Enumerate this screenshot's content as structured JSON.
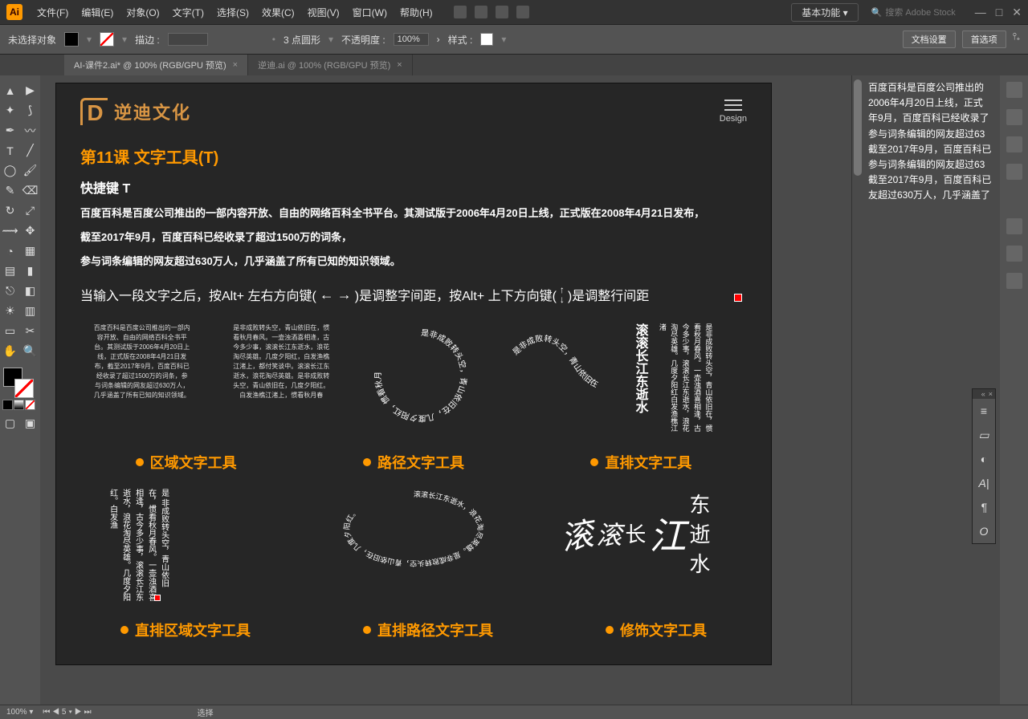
{
  "menubar": {
    "logo": "Ai",
    "items": [
      "文件(F)",
      "编辑(E)",
      "对象(O)",
      "文字(T)",
      "选择(S)",
      "效果(C)",
      "视图(V)",
      "窗口(W)",
      "帮助(H)"
    ],
    "workspace": "基本功能",
    "search_placeholder": "搜索 Adobe Stock"
  },
  "controlbar": {
    "selection": "未选择对象",
    "stroke_label": "描边 :",
    "shape_label": "3 点圆形",
    "opacity_label": "不透明度 :",
    "opacity_value": "100%",
    "style_label": "样式 :",
    "doc_setup": "文档设置",
    "prefs": "首选项"
  },
  "tabs": {
    "active": "AI-课件2.ai* @ 100% (RGB/GPU 预览)",
    "inactive": "逆迪.ai @ 100% (RGB/GPU 预览)"
  },
  "artboard": {
    "brand": "逆迪文化",
    "design_label": "Design",
    "lesson_title": "第11课   文字工具(T)",
    "shortcut_label": "快捷键 T",
    "para1": "百度百科是百度公司推出的一部内容开放、自由的网络百科全书平台。其测试版于2006年4月20日上线，正式版在2008年4月21日发布，",
    "para2": "截至2017年9月，百度百科已经收录了超过1500万的词条，",
    "para3": "参与词条编辑的网友超过630万人，几乎涵盖了所有已知的知识领域。",
    "hint_prefix": "当输入一段文字之后，按Alt+ 左右方向键(",
    "hint_mid": ")是调整字间距，按Alt+ 上下方向键(",
    "hint_suffix": ")是调整行间距",
    "tool1": "区域文字工具",
    "tool2": "路径文字工具",
    "tool3": "直排文字工具",
    "tool4": "直排区域文字工具",
    "tool5": "直排路径文字工具",
    "tool6": "修饰文字工具",
    "sample_tiny": "百度百科是百度公司推出的一部内容开放、自由的网络百科全书平台。其测试版于2006年4月20日上线，正式版在2008年4月21日发布，截至2017年9月，百度百科已经收录了超过1500万的词条，参与词条编辑的网友超过630万人，几乎涵盖了所有已知的知识领域。",
    "sample_tiny2": "是非成败转头空，青山依旧在，惯看秋月春风。一壶浊酒喜相逢，古今多少事，滚滚长江东逝水，浪花淘尽英雄。几度夕阳红，白发渔樵江渚上，都付笑谈中。滚滚长江东逝水，浪花淘尽英雄。是非成败转头空，青山依旧在，几度夕阳红。白发渔樵江渚上，惯看秋月春",
    "vert_text_header": "滚滚长江东逝水",
    "vert_text": "是非成败转头空，青山依旧在，惯看秋月春风。一壶浊酒喜相逢，古今多少事，滚滚长江东逝水，浪花淘尽英雄。几度夕阳红白发渔樵江渚",
    "vert_area": "是\n非成败转头空，青山依旧在，惯看秋月春风。一壶浊酒喜相逢，古今多少事，滚滚长江东逝水，浪花淘尽英雄。几度夕阳红。白发渔",
    "styled_text": "滚 滚 长 江 东逝水"
  },
  "overflow_text": {
    "l1": "百度百科是百度公司推出的",
    "l2": "2006年4月20日上线，正式",
    "l3": "年9月，百度百科已经收录了",
    "l4": "参与词条编辑的网友超过63",
    "l5": "截至2017年9月，百度百科已",
    "l6": "参与词条编辑的网友超过63",
    "l7": "截至2017年9月，百度百科已",
    "l8": "友超过630万人，几乎涵盖了"
  },
  "statusbar": {
    "zoom": "100%",
    "nav": "5",
    "sel": "选择"
  }
}
